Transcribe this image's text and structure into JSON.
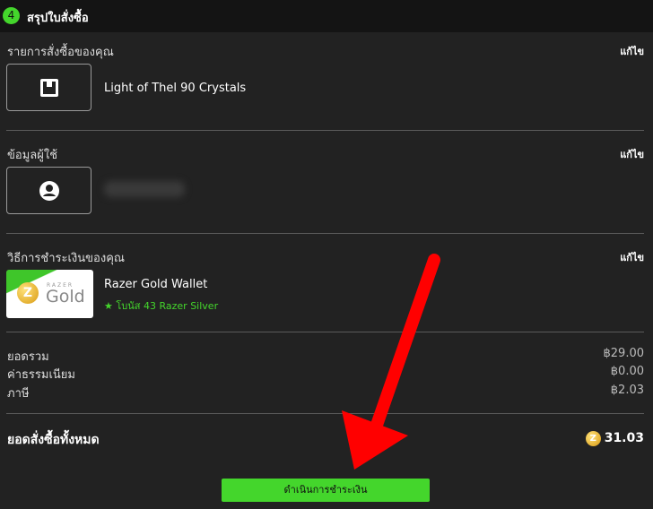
{
  "header": {
    "step_number": "4",
    "title": "สรุปใบสั่งซื้อ"
  },
  "order": {
    "label": "รายการสั่งซื้อของคุณ",
    "edit_label": "แก้ไข",
    "product_name": "Light of Thel 90 Crystals",
    "icon": "box-icon"
  },
  "user": {
    "label": "ข้อมูลผู้ใช้",
    "edit_label": "แก้ไข",
    "icon": "user-icon"
  },
  "payment": {
    "label": "วิธีการชำระเงินของคุณ",
    "edit_label": "แก้ไข",
    "method_name": "Razer Gold Wallet",
    "bonus_star": "★",
    "bonus_text": "โบนัส 43 Razer Silver",
    "card_brand": "RAZER",
    "card_word": "Gold",
    "card_coin_letter": "Z"
  },
  "summary": {
    "subtotal_label": "ยอดรวม",
    "subtotal_value": "฿29.00",
    "fee_label": "ค่าธรรมเนียม",
    "fee_value": "฿0.00",
    "tax_label": "ภาษี",
    "tax_value": "฿2.03",
    "total_label": "ยอดสั่งซื้อทั้งหมด",
    "total_coin_letter": "Z",
    "total_value": "31.03"
  },
  "actions": {
    "pay_label": "ดำเนินการชำระเงิน"
  },
  "colors": {
    "accent": "#44d62c",
    "arrow": "#ff0000",
    "background": "#222222",
    "header_background": "#141414"
  }
}
